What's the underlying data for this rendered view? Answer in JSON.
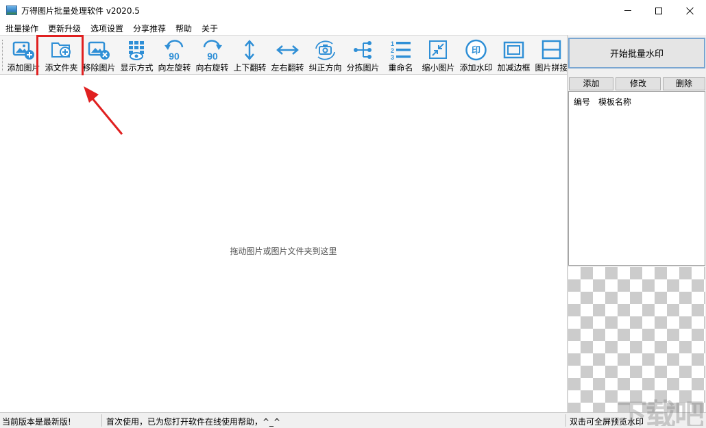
{
  "window": {
    "title": "万得图片批量处理软件 v2020.5"
  },
  "menu": [
    "批量操作",
    "更新升级",
    "选项设置",
    "分享推荐",
    "帮助",
    "关于"
  ],
  "toolbar": {
    "items": [
      {
        "label": "添加图片",
        "icon": "add-image-icon"
      },
      {
        "label": "添文件夹",
        "icon": "add-folder-icon"
      },
      {
        "label": "移除图片",
        "icon": "remove-image-icon"
      },
      {
        "label": "显示方式",
        "icon": "view-mode-icon"
      },
      {
        "label": "向左旋转",
        "icon": "rotate-left-icon",
        "glyph": "90"
      },
      {
        "label": "向右旋转",
        "icon": "rotate-right-icon",
        "glyph": "90"
      },
      {
        "label": "上下翻转",
        "icon": "flip-vertical-icon"
      },
      {
        "label": "左右翻转",
        "icon": "flip-horizontal-icon"
      },
      {
        "label": "纠正方向",
        "icon": "correct-orientation-icon"
      },
      {
        "label": "分拣图片",
        "icon": "sort-images-icon"
      },
      {
        "label": "重命名",
        "icon": "rename-icon"
      },
      {
        "label": "缩小图片",
        "icon": "shrink-image-icon"
      },
      {
        "label": "添加水印",
        "icon": "add-watermark-icon",
        "glyph": "印"
      },
      {
        "label": "加减边框",
        "icon": "border-icon"
      },
      {
        "label": "图片拼接",
        "icon": "stitch-icon"
      }
    ]
  },
  "main": {
    "drop_hint": "拖动图片或图片文件夹到这里"
  },
  "right_panel": {
    "start_button": "开始批量水印",
    "add_button": "添加",
    "edit_button": "修改",
    "delete_button": "删除",
    "columns": [
      "编号",
      "模板名称"
    ]
  },
  "status": {
    "version": "当前版本是最新版!",
    "message": "首次使用，已为您打开软件在线使用帮助，^_^",
    "hint": "双击可全屏预览水印"
  },
  "colors": {
    "icon_blue": "#2f8fd6",
    "highlight_red": "#e02020"
  }
}
